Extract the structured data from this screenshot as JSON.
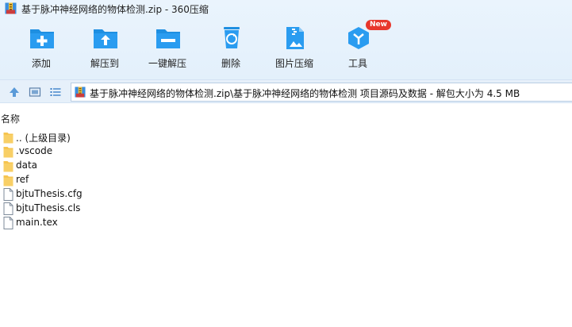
{
  "window": {
    "title": "基于脉冲神经网络的物体检测.zip - 360压缩"
  },
  "toolbar": {
    "items": [
      {
        "label": "添加",
        "icon": "add-icon"
      },
      {
        "label": "解压到",
        "icon": "extract-to-icon"
      },
      {
        "label": "一键解压",
        "icon": "one-click-extract-icon"
      },
      {
        "label": "删除",
        "icon": "recycle-bin-icon"
      },
      {
        "label": "图片压缩",
        "icon": "image-compress-icon"
      },
      {
        "label": "工具",
        "icon": "tools-icon",
        "badge": "New"
      }
    ]
  },
  "address": {
    "path": "基于脉冲神经网络的物体检测.zip\\基于脉冲神经网络的物体检测 项目源码及数据 - 解包大小为 4.5 MB"
  },
  "file_list": {
    "column_header": "名称",
    "items": [
      {
        "name": ".. (上级目录)",
        "type": "folder"
      },
      {
        "name": ".vscode",
        "type": "folder"
      },
      {
        "name": "data",
        "type": "folder"
      },
      {
        "name": "ref",
        "type": "folder"
      },
      {
        "name": "bjtuThesis.cfg",
        "type": "file"
      },
      {
        "name": "bjtuThesis.cls",
        "type": "file"
      },
      {
        "name": "main.tex",
        "type": "file"
      }
    ]
  },
  "colors": {
    "accent": "#1e8fe1",
    "folder": "#f6c44f",
    "badge": "#e8372c"
  }
}
